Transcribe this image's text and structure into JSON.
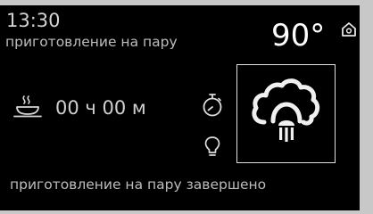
{
  "header": {
    "time": "13:30",
    "mode_title": "приготовление на пару",
    "temperature": "90°"
  },
  "cooking": {
    "duration": "00 ч 00 м"
  },
  "program": {
    "icon": "steam-icon"
  },
  "footer": {
    "status": "приготовление на пару завершено"
  },
  "icons": {
    "home": "home-icon",
    "cook": "cooking-pot-icon",
    "timer": "stopwatch-icon",
    "light": "light-bulb-icon"
  },
  "colors": {
    "screen_background": "#000000",
    "text_primary": "#ffffff",
    "text_secondary": "#bdbdbd",
    "bezel": "#c8c8c8"
  }
}
